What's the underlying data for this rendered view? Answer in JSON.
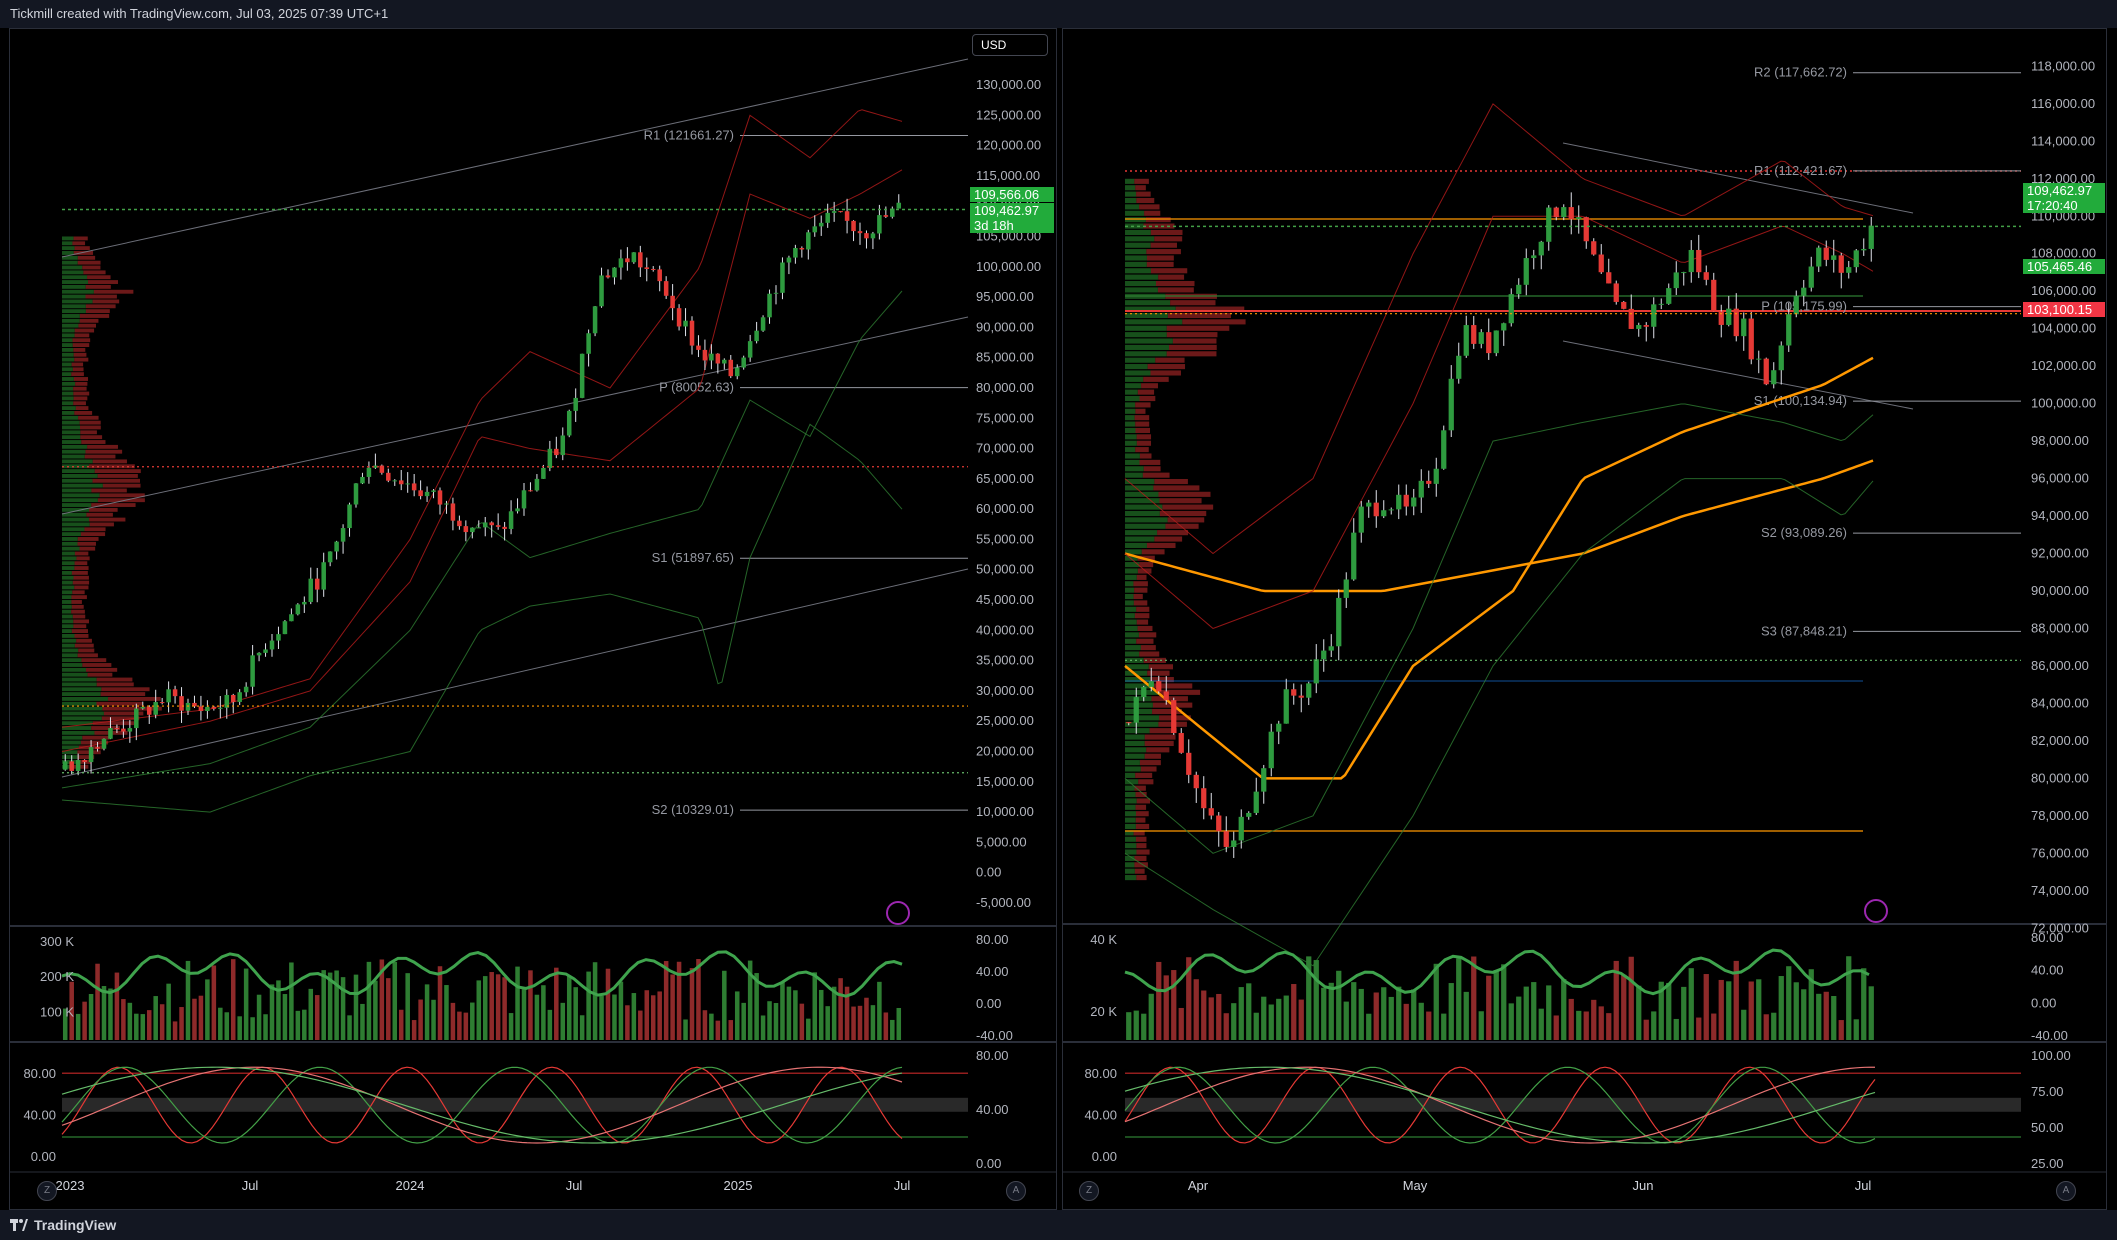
{
  "header": {
    "created": "Tickmill created with TradingView.com, Jul 03, 2025 07:39 UTC+1"
  },
  "footer": {
    "brand": "TradingView"
  },
  "colors": {
    "up": "#26a69a",
    "down": "#ef5350",
    "green": "#2e7d32",
    "red": "#c62828",
    "orange": "#ff9800",
    "yellow": "#ffeb3b",
    "grid": "#2a2e39"
  },
  "left": {
    "currency": "USD",
    "price_axis": [
      "130,000.00",
      "125,000.00",
      "120,000.00",
      "115,000.00",
      "110,000.00",
      "105,000.00",
      "100,000.00",
      "95,000.00",
      "90,000.00",
      "85,000.00",
      "80,000.00",
      "75,000.00",
      "70,000.00",
      "65,000.00",
      "60,000.00",
      "55,000.00",
      "50,000.00",
      "45,000.00",
      "40,000.00",
      "35,000.00",
      "30,000.00",
      "25,000.00",
      "20,000.00",
      "15,000.00",
      "10,000.00",
      "5,000.00",
      "0.00",
      "-5,000.00"
    ],
    "price_tags": [
      {
        "text": "109,566.06",
        "color": "green"
      },
      {
        "text": "109,462.97",
        "color": "green"
      },
      {
        "text": "3d 18h",
        "color": "green"
      }
    ],
    "pivots": [
      {
        "label": "R1 (121661.27)",
        "value": 121661.27
      },
      {
        "label": "P (80052.63)",
        "value": 80052.63
      },
      {
        "label": "S1 (51897.65)",
        "value": 51897.65
      },
      {
        "label": "S2 (10329.01)",
        "value": 10329.01
      }
    ],
    "time_axis": [
      "2023",
      "Jul",
      "2024",
      "Jul",
      "2025",
      "Jul"
    ],
    "volume_axis": [
      "300 K",
      "200 K",
      "100 K"
    ],
    "osc1_axis": [
      "80.00",
      "40.00",
      "0.00",
      "-40.00"
    ],
    "osc2_axis": [
      "80.00",
      "40.00",
      "0.00"
    ],
    "corner_z": "Z",
    "corner_a": "A"
  },
  "right": {
    "price_axis": [
      "118,000.00",
      "116,000.00",
      "114,000.00",
      "112,000.00",
      "110,000.00",
      "108,000.00",
      "106,000.00",
      "104,000.00",
      "102,000.00",
      "100,000.00",
      "98,000.00",
      "96,000.00",
      "94,000.00",
      "92,000.00",
      "90,000.00",
      "88,000.00",
      "86,000.00",
      "84,000.00",
      "82,000.00",
      "80,000.00",
      "78,000.00",
      "76,000.00",
      "74,000.00",
      "72,000.00"
    ],
    "price_tags": [
      {
        "text": "109,462.97",
        "color": "green"
      },
      {
        "text": "17:20:40",
        "color": "green"
      },
      {
        "text": "105,465.46",
        "color": "green"
      },
      {
        "text": "103,100.15",
        "color": "red"
      }
    ],
    "pivots": [
      {
        "label": "R2 (117,662.72)",
        "value": 117662.72
      },
      {
        "label": "R1 (112,421.67)",
        "value": 112421.67
      },
      {
        "label": "P (105,175.99)",
        "value": 105175.99
      },
      {
        "label": "S1 (100,134.94)",
        "value": 100134.94
      },
      {
        "label": "S2 (93,089.26)",
        "value": 93089.26
      },
      {
        "label": "S3 (87,848.21)",
        "value": 87848.21
      }
    ],
    "time_axis": [
      "Apr",
      "May",
      "Jun",
      "Jul"
    ],
    "volume_axis": [
      "40 K",
      "20 K"
    ],
    "osc1_axis": [
      "80.00",
      "40.00",
      "0.00",
      "-40.00"
    ],
    "osc2_axis_left": [
      "80.00",
      "40.00",
      "0.00"
    ],
    "osc2_axis_right": [
      "100.00",
      "75.00",
      "50.00",
      "25.00"
    ],
    "corner_z": "Z",
    "corner_a": "A"
  },
  "chart_data": [
    {
      "type": "candlestick",
      "title": "",
      "ylim": [
        -5000,
        130000
      ],
      "x": [
        "2023",
        "Jul",
        "2024",
        "Jul",
        "2025",
        "Jul"
      ],
      "series": [
        {
          "values": [
            17000,
            22000,
            25000,
            29000,
            27000,
            28000,
            38000,
            44000,
            52000,
            68000,
            65000,
            62000,
            58000,
            56000,
            64000,
            72000,
            98000,
            102000,
            96000,
            86000,
            82000,
            94000,
            104000,
            108000,
            106000,
            109463
          ]
        }
      ],
      "levels": [
        {
          "label": "R1 (121661.27)",
          "value": 121661.27
        },
        {
          "label": "P (80052.63)",
          "value": 80052.63
        },
        {
          "label": "S1 (51897.65)",
          "value": 51897.65
        },
        {
          "label": "S2 (10329.01)",
          "value": 10329.01
        }
      ],
      "last_price": 109462.97,
      "grid": false
    },
    {
      "type": "candlestick",
      "title": "",
      "ylim": [
        71000,
        118500
      ],
      "x": [
        "Apr",
        "May",
        "Jun",
        "Jul"
      ],
      "series": [
        {
          "values": [
            83000,
            86000,
            82000,
            78000,
            76000,
            80000,
            84000,
            85000,
            88000,
            94000,
            95000,
            94000,
            97000,
            104000,
            103000,
            106000,
            109000,
            111000,
            108000,
            105000,
            104000,
            106000,
            108000,
            105000,
            104000,
            101000,
            106000,
            108000,
            107000,
            109463
          ]
        }
      ],
      "levels": [
        {
          "label": "R2 (117,662.72)",
          "value": 117662.72
        },
        {
          "label": "R1 (112,421.67)",
          "value": 112421.67
        },
        {
          "label": "P (105,175.99)",
          "value": 105175.99
        },
        {
          "label": "S1 (100,134.94)",
          "value": 100134.94
        },
        {
          "label": "S2 (93,089.26)",
          "value": 93089.26
        },
        {
          "label": "S3 (87,848.21)",
          "value": 87848.21
        }
      ],
      "last_price": 109462.97,
      "grid": false
    }
  ]
}
